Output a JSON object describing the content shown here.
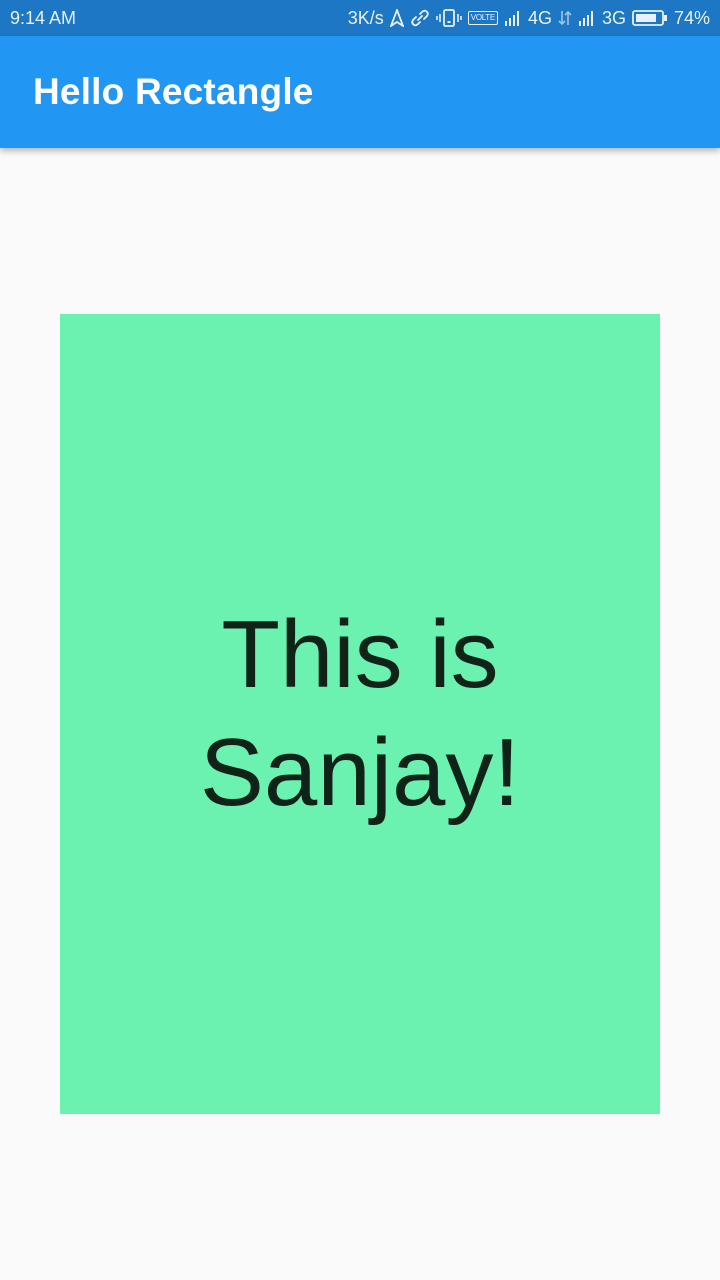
{
  "status_bar": {
    "time": "9:14 AM",
    "network_speed": "3K/s",
    "volte_label": "VOLTE",
    "network_1": "4G",
    "network_2": "3G",
    "battery": "74%",
    "icons": [
      "navigation-arrow-icon",
      "link-icon",
      "vibrate-icon",
      "volte-icon",
      "signal-icon",
      "data-arrows-icon",
      "signal-icon",
      "battery-icon"
    ],
    "background_color": "#1d77c4"
  },
  "app_bar": {
    "title": "Hello Rectangle",
    "background_color": "#2196f3"
  },
  "main": {
    "rectangle": {
      "text": "This is Sanjay!",
      "background_color": "#6bf2b0",
      "text_color": "#102319"
    },
    "background_color": "#fafafa"
  }
}
